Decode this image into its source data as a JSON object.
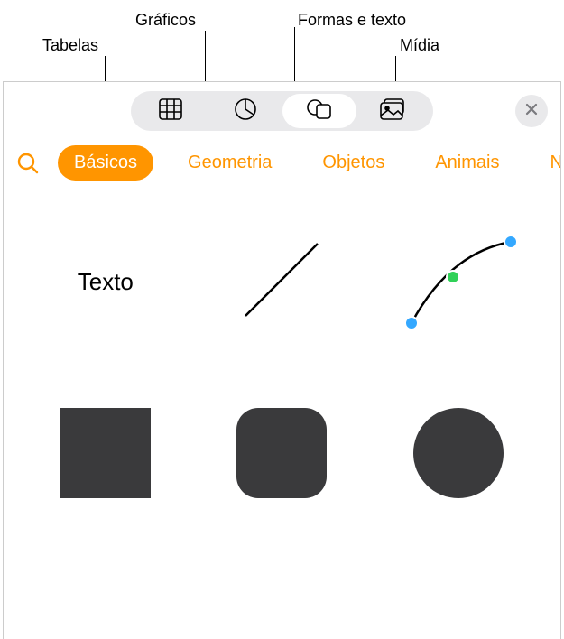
{
  "callouts": {
    "tables": "Tabelas",
    "charts": "Gráficos",
    "shapes_text": "Formas e texto",
    "media": "Mídia"
  },
  "categories": {
    "basics": "Básicos",
    "geometry": "Geometria",
    "objects": "Objetos",
    "animals": "Animais",
    "partial": "N"
  },
  "shapes": {
    "text_label": "Texto"
  },
  "colors": {
    "accent": "#FF9500",
    "shape_fill": "#3a3a3c"
  }
}
